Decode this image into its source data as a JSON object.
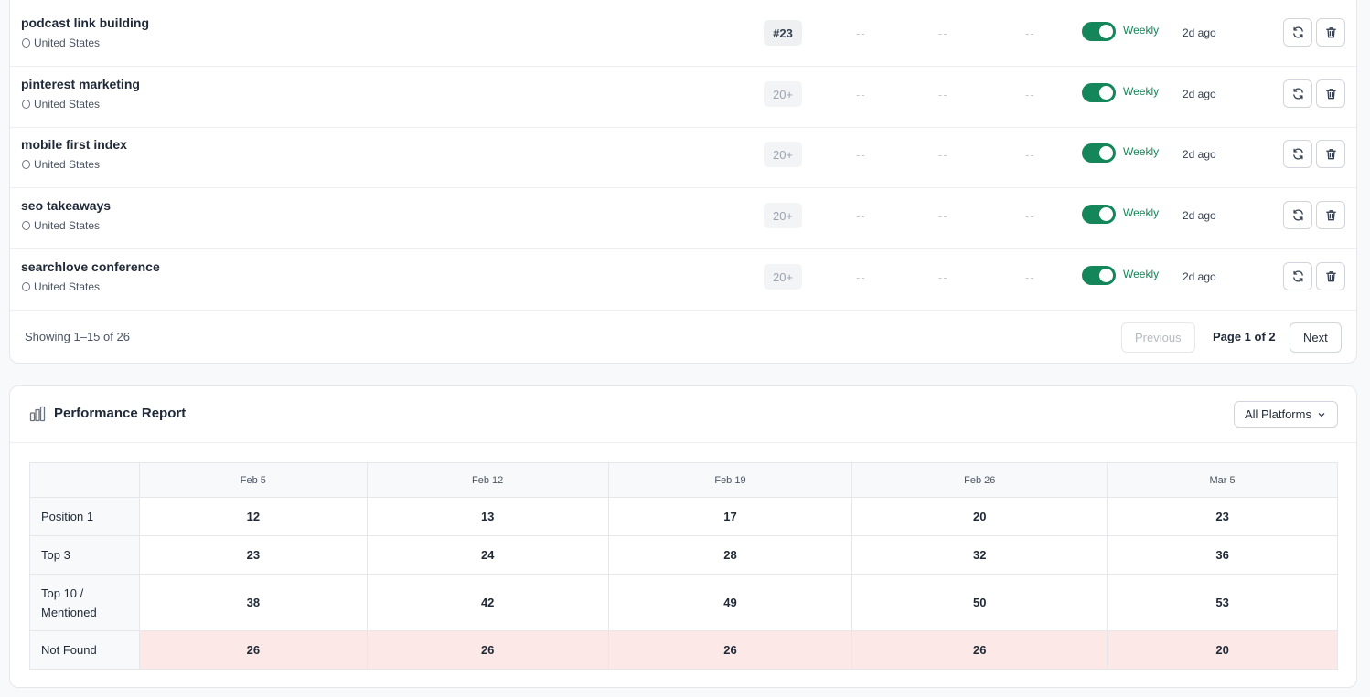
{
  "keywords": [
    {
      "name": "podcast link building",
      "location": "United States",
      "rank": "#23",
      "rank_style": "strong",
      "col1": "--",
      "col2": "--",
      "col3": "--",
      "frequency": "Weekly",
      "updated": "2d ago"
    },
    {
      "name": "pinterest marketing",
      "location": "United States",
      "rank": "20+",
      "rank_style": "weak",
      "col1": "--",
      "col2": "--",
      "col3": "--",
      "frequency": "Weekly",
      "updated": "2d ago"
    },
    {
      "name": "mobile first index",
      "location": "United States",
      "rank": "20+",
      "rank_style": "weak",
      "col1": "--",
      "col2": "--",
      "col3": "--",
      "frequency": "Weekly",
      "updated": "2d ago"
    },
    {
      "name": "seo takeaways",
      "location": "United States",
      "rank": "20+",
      "rank_style": "weak",
      "col1": "--",
      "col2": "--",
      "col3": "--",
      "frequency": "Weekly",
      "updated": "2d ago"
    },
    {
      "name": "searchlove conference",
      "location": "United States",
      "rank": "20+",
      "rank_style": "weak",
      "col1": "--",
      "col2": "--",
      "col3": "--",
      "frequency": "Weekly",
      "updated": "2d ago"
    }
  ],
  "pagination": {
    "showing": "Showing 1–15 of 26",
    "previous": "Previous",
    "page_label": "Page 1 of 2",
    "next": "Next"
  },
  "report": {
    "title": "Performance Report",
    "icon": "bar-chart-icon",
    "platform_select": "All Platforms",
    "columns": [
      "",
      "Feb 5",
      "Feb 12",
      "Feb 19",
      "Feb 26",
      "Mar 5"
    ],
    "rows": [
      {
        "label": "Position 1",
        "values": [
          "12",
          "13",
          "17",
          "20",
          "23"
        ]
      },
      {
        "label": "Top 3",
        "values": [
          "23",
          "24",
          "28",
          "32",
          "36"
        ]
      },
      {
        "label": "Top 10 / Mentioned",
        "values": [
          "38",
          "42",
          "49",
          "50",
          "53"
        ]
      },
      {
        "label": "Not Found",
        "values": [
          "26",
          "26",
          "26",
          "26",
          "20"
        ]
      }
    ]
  },
  "colors": {
    "toggle_on": "#14865a",
    "not_found_bg": "#fde8e8"
  }
}
